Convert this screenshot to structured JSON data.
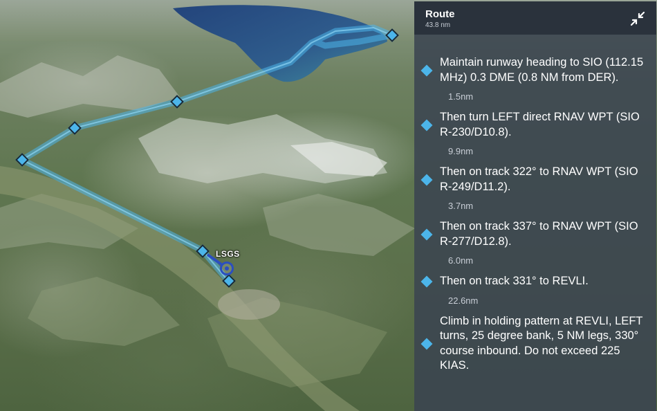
{
  "panel": {
    "title": "Route",
    "total_distance": "43.8 nm",
    "collapse_icon": "collapse-arrows-icon"
  },
  "map": {
    "airport_label": "LSGS",
    "route_color": "#4cb5ea",
    "waypoint_color": "#4cb5ea"
  },
  "steps": [
    {
      "text": "Maintain runway heading to SIO (112.15 MHz) 0.3 DME (0.8 NM from DER).",
      "leg_distance": "1.5nm"
    },
    {
      "text": "Then turn LEFT direct RNAV WPT (SIO R-230/D10.8).",
      "leg_distance": "9.9nm"
    },
    {
      "text": "Then on track 322° to RNAV WPT (SIO R-249/D11.2).",
      "leg_distance": "3.7nm"
    },
    {
      "text": "Then on track 337° to RNAV WPT (SIO R-277/D12.8).",
      "leg_distance": "6.0nm"
    },
    {
      "text": "Then on track 331° to REVLI.",
      "leg_distance": "22.6nm"
    },
    {
      "text": "Climb in holding pattern at REVLI, LEFT turns, 25 degree bank, 5 NM legs, 330° course inbound. Do not exceed 225 KIAS."
    }
  ]
}
